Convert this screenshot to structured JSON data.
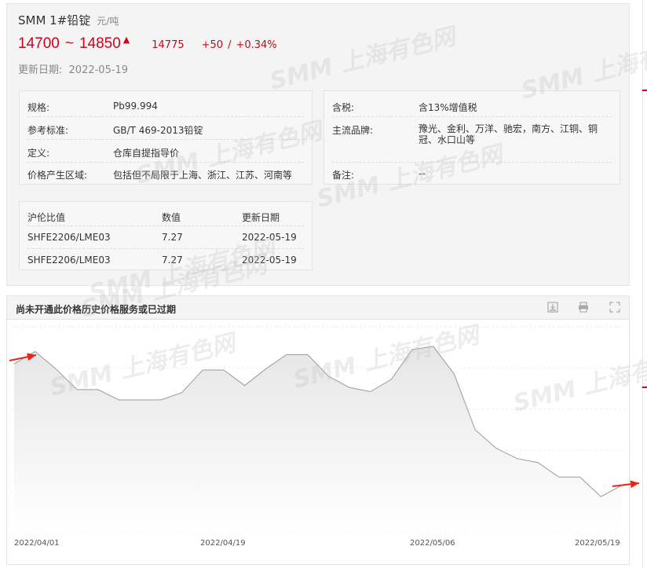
{
  "product": {
    "name": "SMM 1#铅锭",
    "unit": "元/吨",
    "price_low": "14700",
    "tilde": "~",
    "price_high": "14850",
    "average": "14775",
    "change": "+50",
    "separator": "/",
    "change_pct": "+0.34%",
    "updated_label": "更新日期:",
    "updated_date": "2022-05-19"
  },
  "specs": [
    {
      "key": "规格:",
      "value": "Pb99.994"
    },
    {
      "key": "参考标准:",
      "value": "GB/T 469-2013铅锭"
    },
    {
      "key": "定义:",
      "value": "仓库自提指导价"
    },
    {
      "key": "价格产生区域:",
      "value": "包括但不局限于上海、浙江、江苏、河南等"
    }
  ],
  "specs_right": [
    {
      "key": "含税:",
      "value": "含13%增值税"
    },
    {
      "key": "主流品牌:",
      "value_line1": "豫光、金利、万洋、驰宏，南方、江铜、铜",
      "value_line2": "冠、水口山等"
    },
    {
      "key": "备注:",
      "value": "--"
    }
  ],
  "ratio_table": {
    "headers": [
      "沪伦比值",
      "数值",
      "更新日期"
    ],
    "rows": [
      [
        "SHFE2206/LME03",
        "7.27",
        "2022-05-19"
      ],
      [
        "SHFE2206/LME03",
        "7.27",
        "2022-05-19"
      ]
    ]
  },
  "chart": {
    "title": "尚未开通此价格历史价格服务或已过期",
    "tools": [
      "download-icon",
      "print-icon",
      "fullscreen-icon"
    ],
    "x_labels": [
      "2022/04/01",
      "2022/04/19",
      "2022/05/06",
      "2022/05/19"
    ]
  },
  "chart_data": {
    "type": "area",
    "title": "",
    "xlabel": "",
    "ylabel": "",
    "x_ticks": [
      "2022/04/01",
      "2022/04/19",
      "2022/05/06",
      "2022/05/19"
    ],
    "values": [
      64,
      76,
      59,
      39,
      39,
      29,
      29,
      29,
      36,
      58,
      58,
      43,
      59,
      73,
      73,
      52,
      41,
      37,
      49,
      78,
      81,
      54,
      0,
      -18,
      -28,
      -32,
      -46,
      -46,
      -65,
      -54
    ],
    "ylim": [
      -100,
      100
    ],
    "grid": true,
    "note": "values shown in relative units; no y-axis scale visible"
  },
  "watermark": {
    "logo": "SMM",
    "text": "上海有色网"
  },
  "colors": {
    "accent": "#d0021b",
    "chart_line": "#9a9a9a",
    "chart_fill_top": "#e6e6e6",
    "arrow": "#e8261c"
  }
}
